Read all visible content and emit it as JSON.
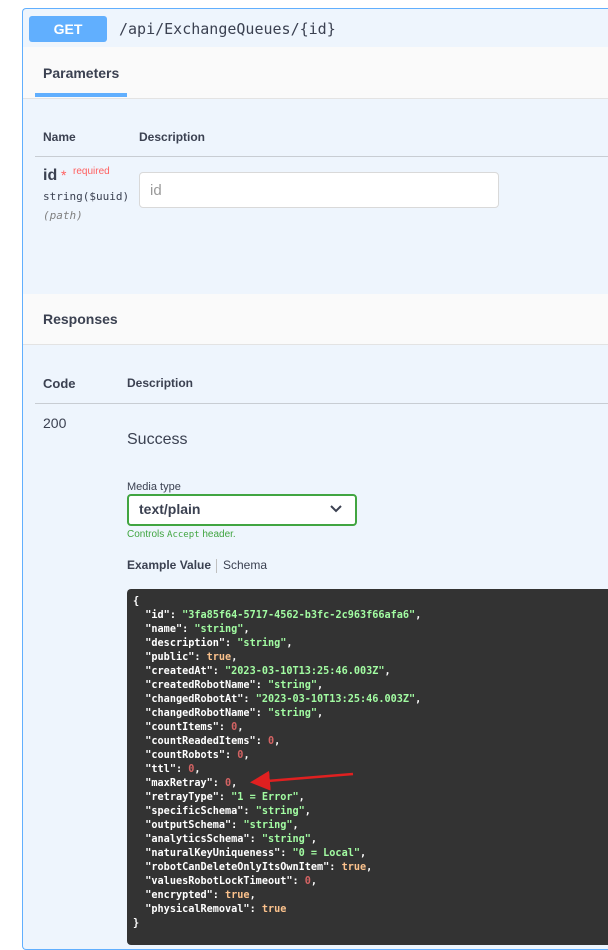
{
  "endpoint": {
    "method": "GET",
    "path": "/api/ExchangeQueues/{id}"
  },
  "parameters": {
    "tab_label": "Parameters",
    "col_name": "Name",
    "col_description": "Description",
    "param": {
      "name": "id",
      "star": "*",
      "required": "required",
      "type": "string($uuid)",
      "location": "(path)",
      "placeholder": "id"
    }
  },
  "responses": {
    "title": "Responses",
    "col_code": "Code",
    "col_description": "Description",
    "code": "200",
    "description": "Success",
    "media_type_label": "Media type",
    "media_type_value": "text/plain",
    "controls_prefix": "Controls",
    "controls_code": "Accept",
    "controls_suffix": "header.",
    "example_value_tab": "Example Value",
    "schema_tab": "Schema"
  },
  "example": {
    "open": "{",
    "close": "}",
    "fields": [
      {
        "key": "\"id\"",
        "value": "\"3fa85f64-5717-4562-b3fc-2c963f66afa6\"",
        "kind": "s",
        "comma": ","
      },
      {
        "key": "\"name\"",
        "value": "\"string\"",
        "kind": "s",
        "comma": ","
      },
      {
        "key": "\"description\"",
        "value": "\"string\"",
        "kind": "s",
        "comma": ","
      },
      {
        "key": "\"public\"",
        "value": "true",
        "kind": "b",
        "comma": ","
      },
      {
        "key": "\"createdAt\"",
        "value": "\"2023-03-10T13:25:46.003Z\"",
        "kind": "s",
        "comma": ","
      },
      {
        "key": "\"createdRobotName\"",
        "value": "\"string\"",
        "kind": "s",
        "comma": ","
      },
      {
        "key": "\"changedRobotAt\"",
        "value": "\"2023-03-10T13:25:46.003Z\"",
        "kind": "s",
        "comma": ","
      },
      {
        "key": "\"changedRobotName\"",
        "value": "\"string\"",
        "kind": "s",
        "comma": ","
      },
      {
        "key": "\"countItems\"",
        "value": "0",
        "kind": "n",
        "comma": ","
      },
      {
        "key": "\"countReadedItems\"",
        "value": "0",
        "kind": "n",
        "comma": ","
      },
      {
        "key": "\"countRobots\"",
        "value": "0",
        "kind": "n",
        "comma": ","
      },
      {
        "key": "\"ttl\"",
        "value": "0",
        "kind": "n",
        "comma": ","
      },
      {
        "key": "\"maxRetray\"",
        "value": "0",
        "kind": "n",
        "comma": ","
      },
      {
        "key": "\"retrayType\"",
        "value": "\"1 = Error\"",
        "kind": "s",
        "comma": ","
      },
      {
        "key": "\"specificSchema\"",
        "value": "\"string\"",
        "kind": "s",
        "comma": ","
      },
      {
        "key": "\"outputSchema\"",
        "value": "\"string\"",
        "kind": "s",
        "comma": ","
      },
      {
        "key": "\"analyticsSchema\"",
        "value": "\"string\"",
        "kind": "s",
        "comma": ","
      },
      {
        "key": "\"naturalKeyUniqueness\"",
        "value": "\"0 = Local\"",
        "kind": "s",
        "comma": ","
      },
      {
        "key": "\"robotCanDeleteOnlyItsOwnItem\"",
        "value": "true",
        "kind": "b",
        "comma": ","
      },
      {
        "key": "\"valuesRobotLockTimeout\"",
        "value": "0",
        "kind": "n",
        "comma": ","
      },
      {
        "key": "\"encrypted\"",
        "value": "true",
        "kind": "b",
        "comma": ","
      },
      {
        "key": "\"physicalRemoval\"",
        "value": "true",
        "kind": "b",
        "comma": ""
      }
    ]
  },
  "colors": {
    "get_blue": "#61affe",
    "panel_bg": "#eef5fd",
    "required_red": "#ff6060",
    "select_green": "#41a541",
    "code_bg": "#333333",
    "annotation_arrow": "#e02020"
  }
}
